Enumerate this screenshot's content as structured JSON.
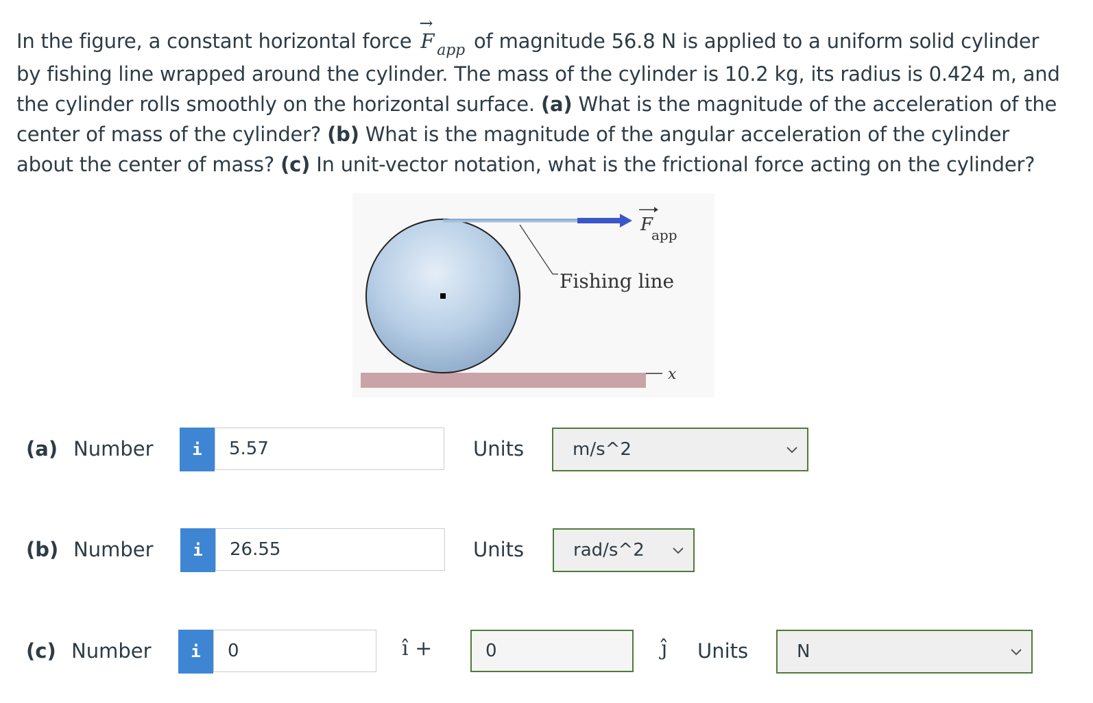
{
  "question": {
    "part1": "In the figure, a constant horizontal force",
    "force_symbol": "F",
    "force_arrow": "→",
    "force_sub": "app",
    "part2": "of magnitude 56.8 N is applied to a uniform solid cylinder by fishing line wrapped around the cylinder. The mass of the cylinder is 10.2 kg, its radius is 0.424 m, and the cylinder rolls smoothly on the horizontal surface.",
    "a_label": "(a)",
    "a_text": "What is the magnitude of the acceleration of the center of mass of the cylinder?",
    "b_label": "(b)",
    "b_text": "What is the magnitude of the angular acceleration of the cylinder about the center of mass?",
    "c_label": "(c)",
    "c_text": "In unit-vector notation, what is the frictional force acting on the cylinder?"
  },
  "figure": {
    "force_label": "F",
    "force_sub": "app",
    "fishing_line_label": "Fishing line",
    "axis_label": "x"
  },
  "answers": {
    "a": {
      "label": "(a)",
      "number_label": "Number",
      "info": "i",
      "value": "5.57",
      "units_label": "Units",
      "unit": "m/s^2"
    },
    "b": {
      "label": "(b)",
      "number_label": "Number",
      "info": "i",
      "value": "26.55",
      "units_label": "Units",
      "unit": "rad/s^2"
    },
    "c": {
      "label": "(c)",
      "number_label": "Number",
      "info": "i",
      "value_i": "0",
      "i_hat": "î +",
      "value_j": "0",
      "j_hat": "ĵ",
      "units_label": "Units",
      "unit": "N"
    }
  },
  "colors": {
    "info_button": "#3e86d4",
    "select_border": "#4f7a3a",
    "text": "#2d3b45"
  }
}
